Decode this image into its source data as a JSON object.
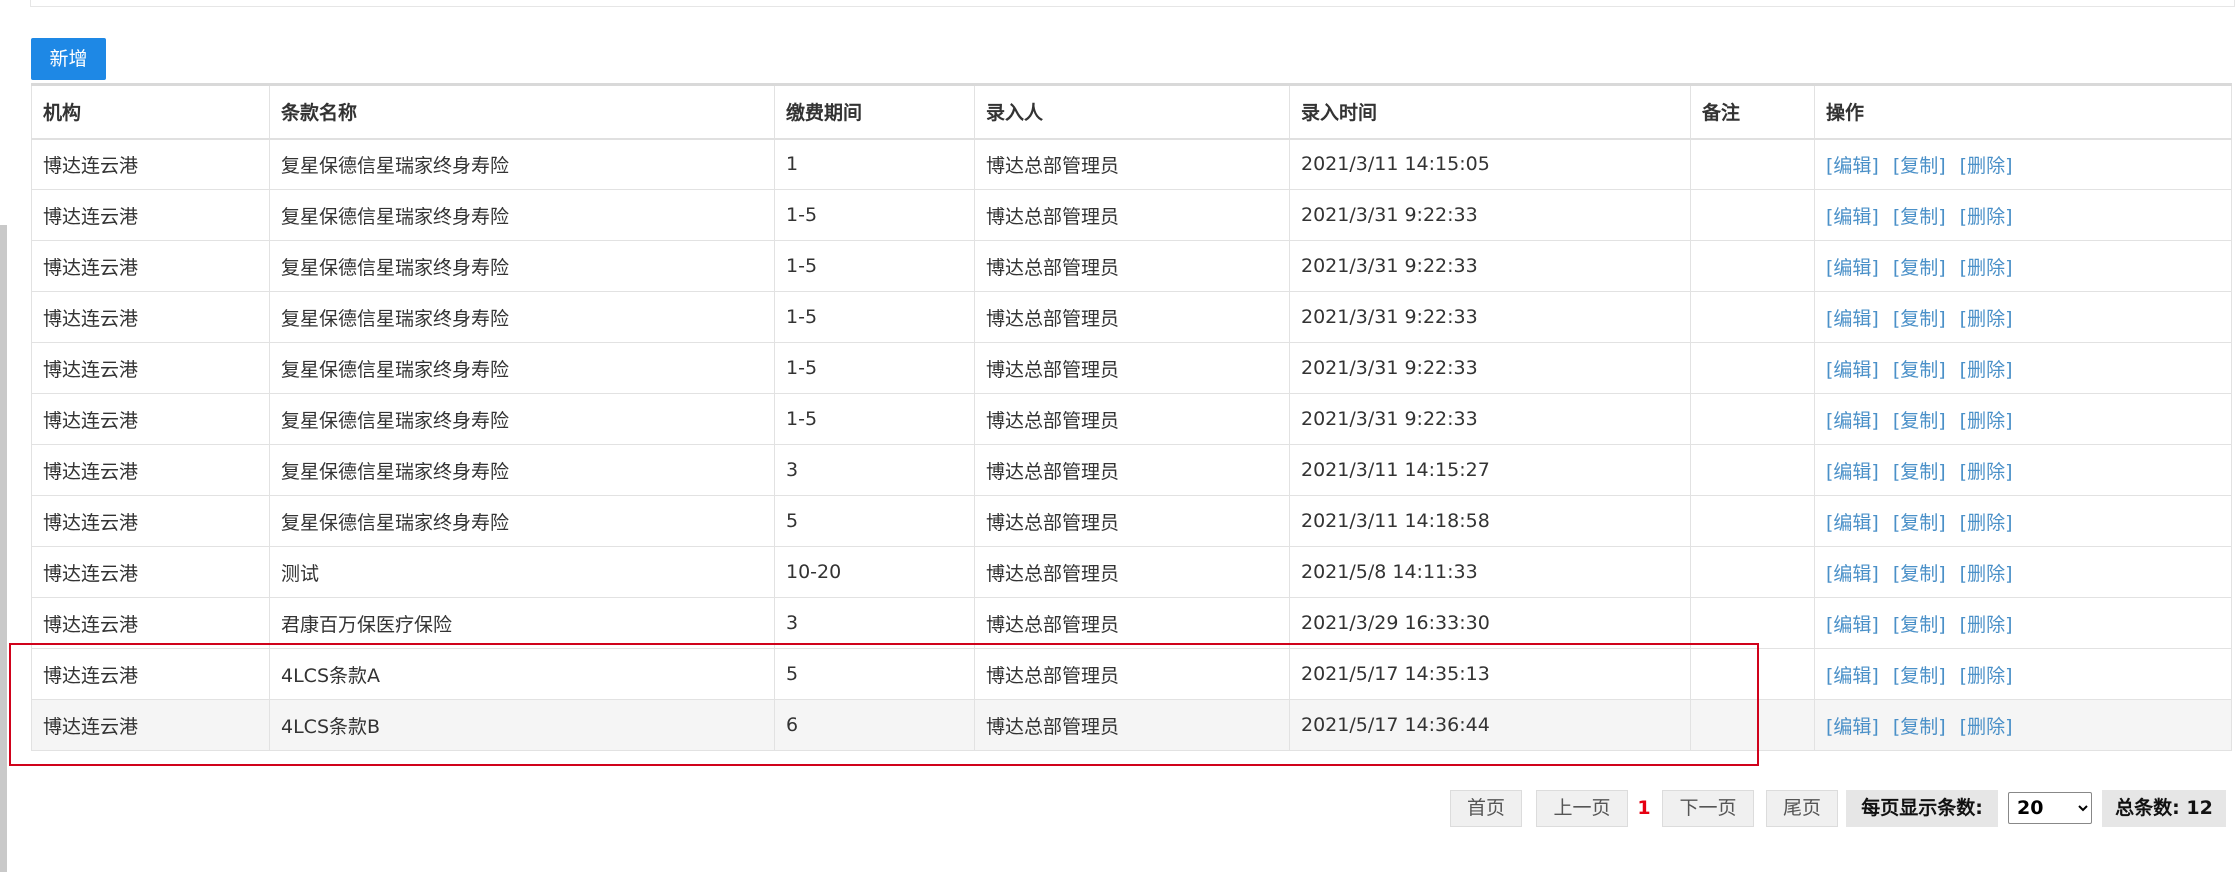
{
  "toolbar": {
    "add_label": "新增"
  },
  "table": {
    "columns": [
      "机构",
      "条款名称",
      "缴费期间",
      "录入人",
      "录入时间",
      "备注",
      "操作"
    ],
    "actions": [
      "[编辑]",
      "[复制]",
      "[删除]"
    ],
    "rows": [
      {
        "org": "博达连云港",
        "name": "复星保德信星瑞家终身寿险",
        "period": "1",
        "entry_by": "博达总部管理员",
        "entry_time": "2021/3/11 14:15:05",
        "remark": ""
      },
      {
        "org": "博达连云港",
        "name": "复星保德信星瑞家终身寿险",
        "period": "1-5",
        "entry_by": "博达总部管理员",
        "entry_time": "2021/3/31 9:22:33",
        "remark": ""
      },
      {
        "org": "博达连云港",
        "name": "复星保德信星瑞家终身寿险",
        "period": "1-5",
        "entry_by": "博达总部管理员",
        "entry_time": "2021/3/31 9:22:33",
        "remark": ""
      },
      {
        "org": "博达连云港",
        "name": "复星保德信星瑞家终身寿险",
        "period": "1-5",
        "entry_by": "博达总部管理员",
        "entry_time": "2021/3/31 9:22:33",
        "remark": ""
      },
      {
        "org": "博达连云港",
        "name": "复星保德信星瑞家终身寿险",
        "period": "1-5",
        "entry_by": "博达总部管理员",
        "entry_time": "2021/3/31 9:22:33",
        "remark": ""
      },
      {
        "org": "博达连云港",
        "name": "复星保德信星瑞家终身寿险",
        "period": "1-5",
        "entry_by": "博达总部管理员",
        "entry_time": "2021/3/31 9:22:33",
        "remark": ""
      },
      {
        "org": "博达连云港",
        "name": "复星保德信星瑞家终身寿险",
        "period": "3",
        "entry_by": "博达总部管理员",
        "entry_time": "2021/3/11 14:15:27",
        "remark": ""
      },
      {
        "org": "博达连云港",
        "name": "复星保德信星瑞家终身寿险",
        "period": "5",
        "entry_by": "博达总部管理员",
        "entry_time": "2021/3/11 14:18:58",
        "remark": ""
      },
      {
        "org": "博达连云港",
        "name": "测试",
        "period": "10-20",
        "entry_by": "博达总部管理员",
        "entry_time": "2021/5/8 14:11:33",
        "remark": ""
      },
      {
        "org": "博达连云港",
        "name": "君康百万保医疗保险",
        "period": "3",
        "entry_by": "博达总部管理员",
        "entry_time": "2021/3/29 16:33:30",
        "remark": ""
      },
      {
        "org": "博达连云港",
        "name": "4LCS条款A",
        "period": "5",
        "entry_by": "博达总部管理员",
        "entry_time": "2021/5/17 14:35:13",
        "remark": ""
      },
      {
        "org": "博达连云港",
        "name": "4LCS条款B",
        "period": "6",
        "entry_by": "博达总部管理员",
        "entry_time": "2021/5/17 14:36:44",
        "remark": ""
      }
    ]
  },
  "pager": {
    "first": "首页",
    "prev": "上一页",
    "current": "1",
    "next": "下一页",
    "last": "尾页",
    "page_size_label": "每页显示条数:",
    "page_size_value": "20",
    "total_label": "总条数: 12"
  },
  "colors": {
    "primary_button": "#1e88e5",
    "link": "#4a90c8",
    "current_page": "#e60012",
    "highlight_border": "#d0021b"
  }
}
